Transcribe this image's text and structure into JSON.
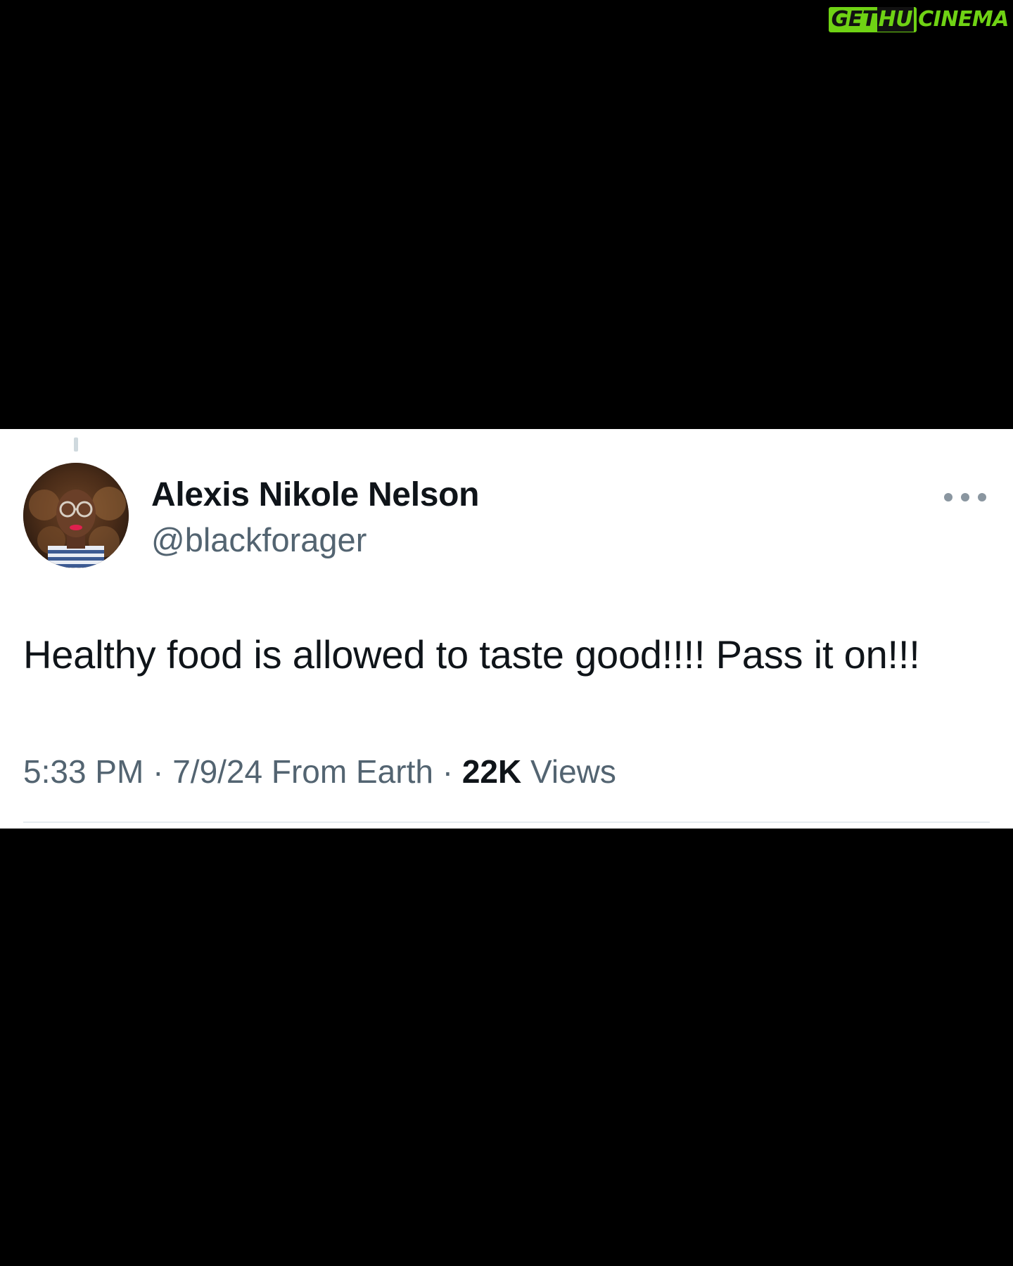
{
  "watermark": {
    "part1": "GET",
    "part2": "HU",
    "part3": "CINEMA",
    "colors": {
      "brand_green": "#6fd214",
      "dark": "#111111"
    }
  },
  "tweet": {
    "author_name": "Alexis Nikole Nelson",
    "author_handle": "@blackforager",
    "text": "Healthy food is allowed to taste good!!!! Pass it on!!!",
    "time": "5:33 PM",
    "separator": "·",
    "date": "7/9/24",
    "source": "From Earth",
    "views_count": "22K",
    "views_label": "Views",
    "avatar_icon": "profile-photo",
    "more_icon": "more-options-icon"
  },
  "colors": {
    "background": "#000000",
    "card": "#ffffff",
    "text_primary": "#0f1419",
    "text_secondary": "#536471"
  }
}
